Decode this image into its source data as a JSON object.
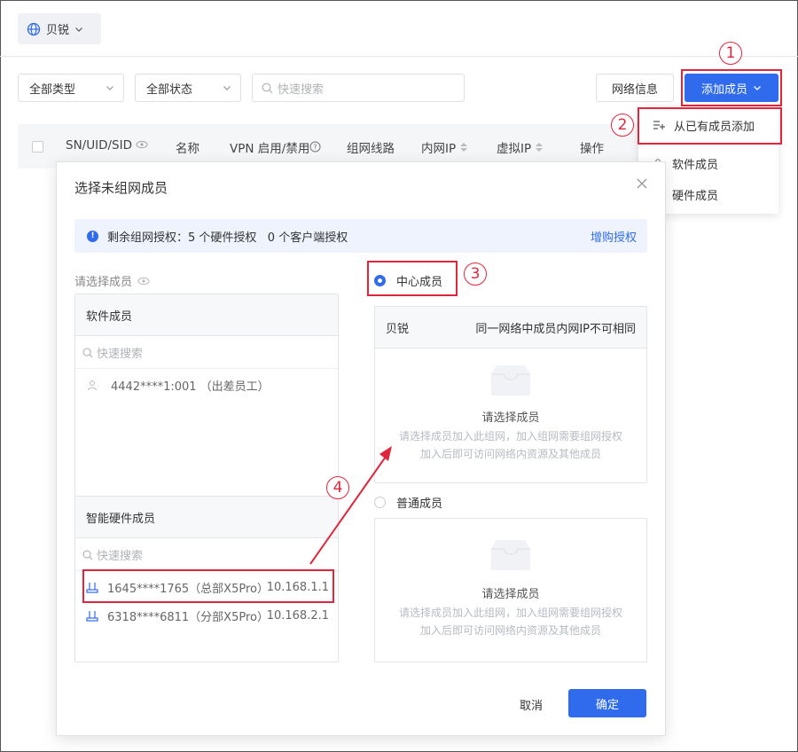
{
  "header": {
    "network_name": "贝锐"
  },
  "filters": {
    "type_select": "全部类型",
    "status_select": "全部状态",
    "search_placeholder": "快速搜索"
  },
  "toolbar": {
    "network_info": "网络信息",
    "add_member": "添加成员"
  },
  "table_headers": [
    "SN/UID/SID",
    "名称",
    "VPN 启用/禁用",
    "组网线路",
    "内网IP",
    "虚拟IP",
    "操作"
  ],
  "dropdown": {
    "items": [
      "从已有成员添加",
      "软件成员",
      "硬件成员"
    ]
  },
  "annotations": {
    "step1": "1",
    "step2": "2",
    "step3": "3",
    "step4": "4"
  },
  "modal": {
    "title": "选择未组网成员",
    "info": "剩余组网授权：5 个硬件授权   0 个客户端授权",
    "info_link": "增购授权",
    "left_label": "请选择成员",
    "software_title": "软件成员",
    "software_search": "快速搜索",
    "software_members": [
      {
        "name": "4442****1:001 （出差员工）"
      }
    ],
    "hardware_title": "智能硬件成员",
    "hardware_search": "快速搜索",
    "hardware_members": [
      {
        "name": "1645****1765（总部X5Pro）",
        "ip": "10.168.1.1"
      },
      {
        "name": "6318****6811（分部X5Pro）",
        "ip": "10.168.2.1"
      }
    ],
    "center_radio": "中心成员",
    "center_network": "贝锐",
    "center_note": "同一网络中成员内网IP不可相同",
    "empty_title": "请选择成员",
    "empty_desc1": "请选择成员加入此组网，加入组网需要组网授权",
    "empty_desc2": "加入后即可访问网络内资源及其他成员",
    "normal_radio": "普通成员",
    "normal_empty_title": "请选择成员",
    "normal_empty_desc1": "请选择成员加入此组网，加入组网需要组网授权",
    "normal_empty_desc2": "加入后即可访问网络内资源及其他成员",
    "cancel": "取消",
    "ok": "确定"
  },
  "colors": {
    "primary": "#2f6bec",
    "annotation_red": "#e0263c"
  }
}
